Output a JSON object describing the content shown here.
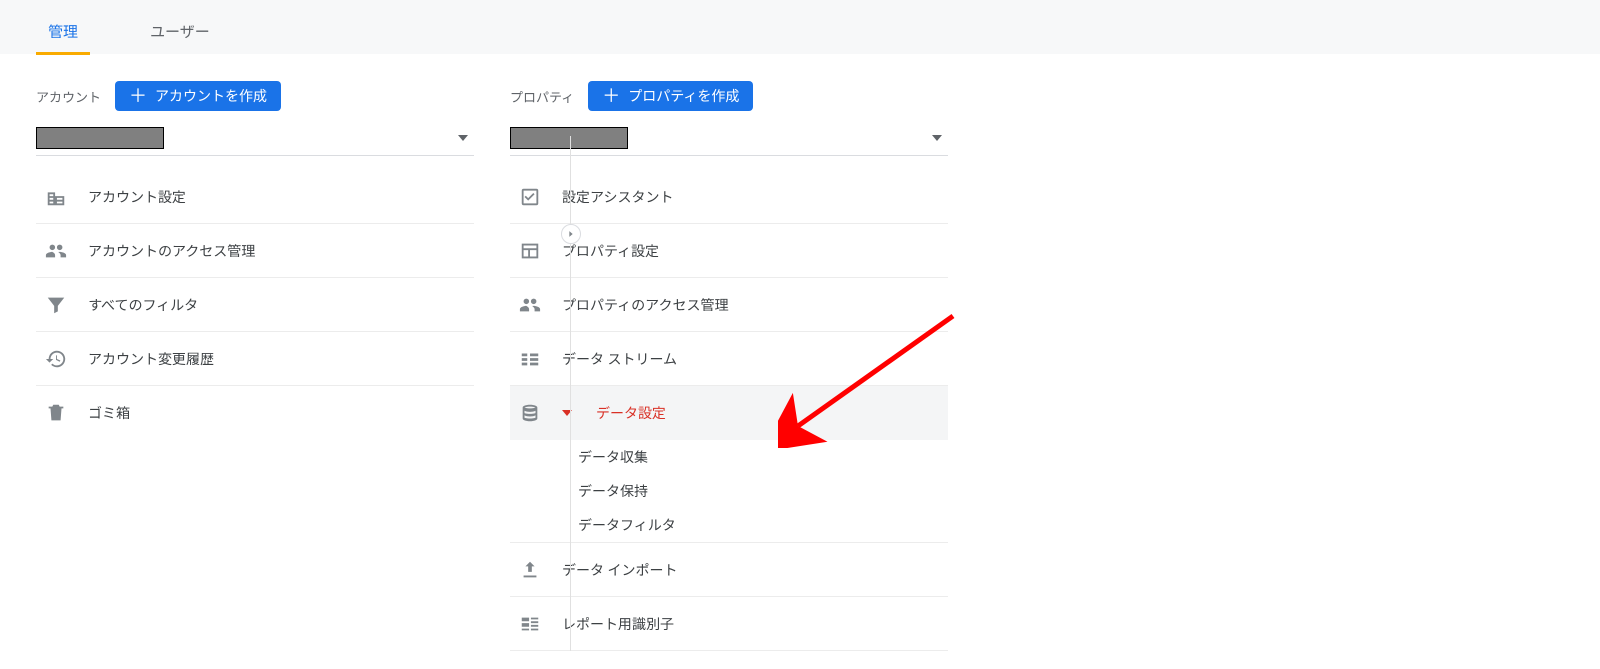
{
  "tabs": {
    "admin": "管理",
    "user": "ユーザー"
  },
  "account": {
    "title": "アカウント",
    "create": "アカウントを作成",
    "items": [
      {
        "label": "アカウント設定",
        "icon": "building"
      },
      {
        "label": "アカウントのアクセス管理",
        "icon": "people"
      },
      {
        "label": "すべてのフィルタ",
        "icon": "funnel"
      },
      {
        "label": "アカウント変更履歴",
        "icon": "history"
      },
      {
        "label": "ゴミ箱",
        "icon": "trash"
      }
    ]
  },
  "property": {
    "title": "プロパティ",
    "create": "プロパティを作成",
    "items": [
      {
        "label": "設定アシスタント",
        "icon": "checkbox"
      },
      {
        "label": "プロパティ設定",
        "icon": "layout"
      },
      {
        "label": "プロパティのアクセス管理",
        "icon": "people"
      },
      {
        "label": "データ ストリーム",
        "icon": "streams"
      }
    ],
    "data_settings": {
      "label": "データ設定",
      "children": [
        {
          "label": "データ収集"
        },
        {
          "label": "データ保持"
        },
        {
          "label": "データフィルタ"
        }
      ]
    },
    "items_after": [
      {
        "label": "データ インポート",
        "icon": "upload"
      },
      {
        "label": "レポート用識別子",
        "icon": "idtag"
      }
    ]
  }
}
